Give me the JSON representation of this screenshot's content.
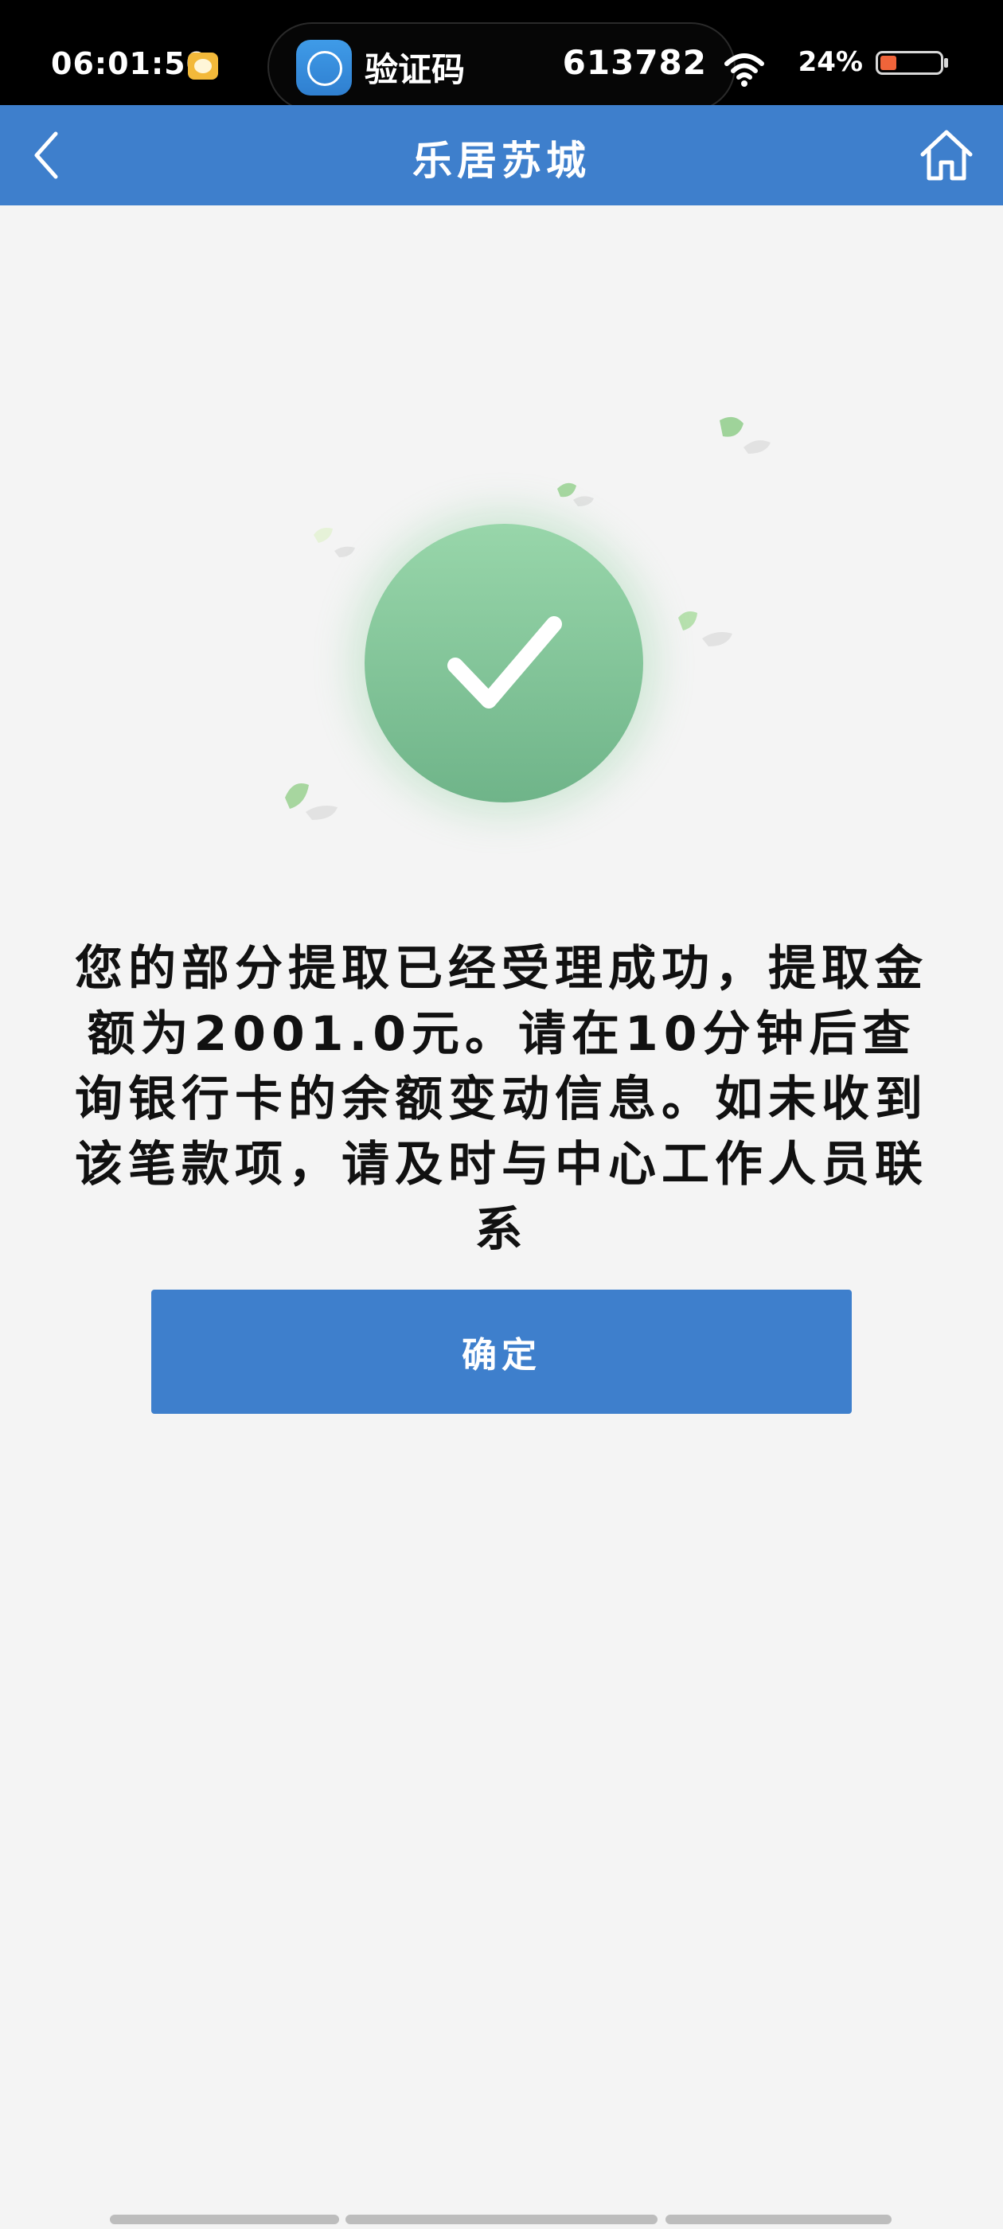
{
  "status_bar": {
    "time": "06:01:50",
    "notification": {
      "app_name": "验证码",
      "code": "613782"
    },
    "battery_percent": "24%",
    "icons": [
      "notification-app-icon",
      "wifi-icon",
      "battery-icon"
    ]
  },
  "nav": {
    "title": "乐居苏城",
    "back_icon": "back-chevron-icon",
    "home_icon": "home-icon"
  },
  "success": {
    "icon": "success-checkmark-icon",
    "message": "您的部分提取已经受理成功，提取金额为2001.0元。请在10分钟后查询银行卡的余额变动信息。如未收到该笔款项，请及时与中心工作人员联系"
  },
  "actions": {
    "confirm_label": "确定"
  },
  "colors": {
    "brand_blue": "#3e7fcc",
    "success_green": "#7fc493",
    "background": "#f4f4f4"
  }
}
